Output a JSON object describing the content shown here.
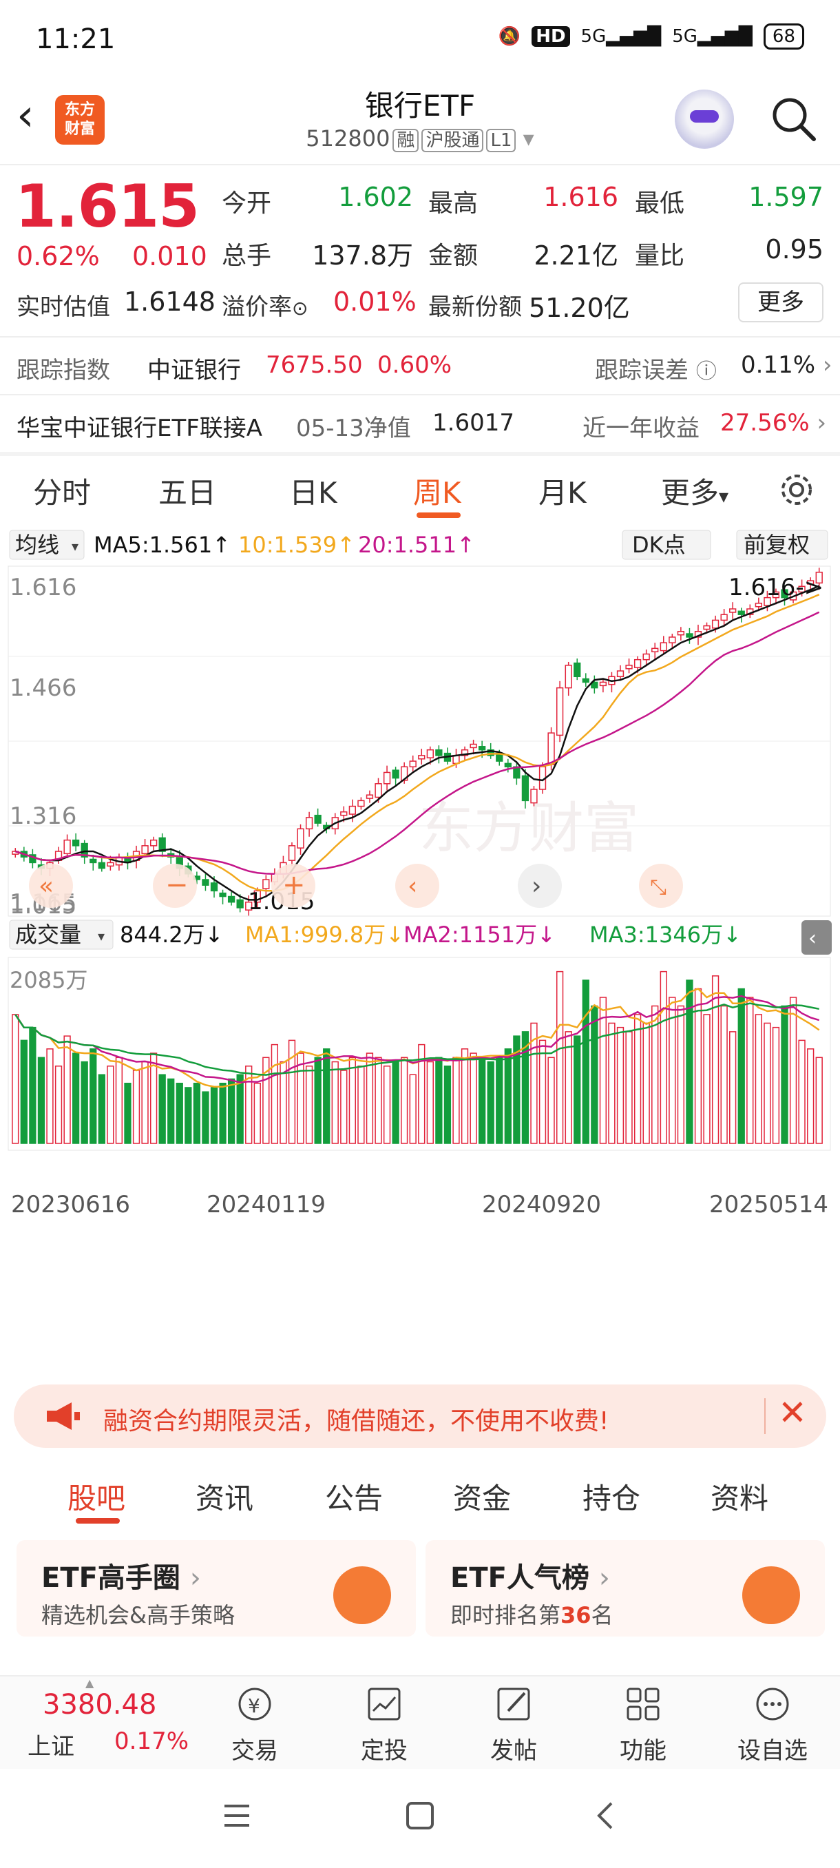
{
  "status": {
    "time": "11:21",
    "network1": "HD",
    "sig1": "5G",
    "sig2": "5G",
    "battery": "68"
  },
  "header": {
    "title": "银行ETF",
    "code": "512800",
    "tag1": "融",
    "tag2": "沪股通",
    "tag3": "L1",
    "logo_line1": "东方",
    "logo_line2": "财富"
  },
  "quote": {
    "price": "1.615",
    "change_pct": "0.62%",
    "change_abs": "0.010",
    "open_label": "今开",
    "open": "1.602",
    "high_label": "最高",
    "high": "1.616",
    "low_label": "最低",
    "low": "1.597",
    "volume_label": "总手",
    "volume": "137.8万",
    "amount_label": "金额",
    "amount": "2.21亿",
    "ratio_label": "量比",
    "ratio": "0.95",
    "iopv_label": "实时估值",
    "iopv": "1.6148",
    "premium_label": "溢价率",
    "premium": "0.01%",
    "shares_label": "最新份额",
    "shares": "51.20亿",
    "more_label": "更多"
  },
  "tracking": {
    "index_label": "跟踪指数",
    "index_name": "中证银行",
    "index_value": "7675.50",
    "index_pct": "0.60%",
    "error_label": "跟踪误差",
    "error_value": "0.11%"
  },
  "feeder": {
    "name": "华宝中证银行ETF联接A",
    "nav_label": "05-13净值",
    "nav": "1.6017",
    "ret_label": "近一年收益",
    "ret": "27.56%"
  },
  "kline_tabs": [
    "分时",
    "五日",
    "日K",
    "周K",
    "月K",
    "更多"
  ],
  "active_tab": "周K",
  "chart_header": {
    "indicator": "均线",
    "ma5": "MA5:1.561↑",
    "ma10": "10:1.539↑",
    "ma20": "20:1.511↑",
    "dk_label": "DK点",
    "adjust_label": "前复权"
  },
  "volume_header": {
    "indicator": "成交量",
    "vol": "844.2万↓",
    "ma1": "MA1:999.8万↓",
    "ma2": "MA2:1151万↓",
    "ma3": "MA3:1346万↓",
    "max_label": "2085万"
  },
  "chart_data": {
    "type": "candlestick",
    "period": "weekly",
    "y_ticks": [
      "1.616",
      "1.466",
      "1.316",
      "1.165",
      "1.015"
    ],
    "ylim": [
      1.015,
      1.616
    ],
    "x_ticks": [
      "20230616",
      "20240119",
      "20240920",
      "20250514"
    ],
    "max_label": "1.616->",
    "min_label": "1.015",
    "ma_colors": {
      "ma5": "#111111",
      "ma10": "#f2a81d",
      "ma20": "#c4168a"
    },
    "close_series": [
      1.12,
      1.11,
      1.1,
      1.09,
      1.1,
      1.12,
      1.14,
      1.13,
      1.11,
      1.1,
      1.09,
      1.1,
      1.11,
      1.1,
      1.12,
      1.13,
      1.14,
      1.12,
      1.11,
      1.09,
      1.08,
      1.07,
      1.06,
      1.05,
      1.04,
      1.03,
      1.02,
      1.03,
      1.05,
      1.07,
      1.08,
      1.1,
      1.13,
      1.16,
      1.18,
      1.17,
      1.16,
      1.18,
      1.19,
      1.2,
      1.21,
      1.22,
      1.24,
      1.26,
      1.25,
      1.27,
      1.28,
      1.29,
      1.3,
      1.29,
      1.28,
      1.29,
      1.3,
      1.31,
      1.3,
      1.29,
      1.28,
      1.27,
      1.25,
      1.21,
      1.23,
      1.27,
      1.33,
      1.41,
      1.45,
      1.43,
      1.42,
      1.41,
      1.42,
      1.43,
      1.44,
      1.45,
      1.46,
      1.47,
      1.48,
      1.49,
      1.5,
      1.51,
      1.5,
      1.51,
      1.52,
      1.53,
      1.54,
      1.55,
      1.54,
      1.55,
      1.56,
      1.57,
      1.58,
      1.57,
      1.58,
      1.59,
      1.6,
      1.615
    ],
    "vol_series": [
      1500,
      1200,
      1350,
      1000,
      1100,
      900,
      1250,
      1050,
      950,
      1100,
      800,
      900,
      1000,
      700,
      850,
      950,
      1050,
      800,
      750,
      700,
      650,
      700,
      600,
      650,
      700,
      750,
      800,
      900,
      700,
      1000,
      1150,
      950,
      1200,
      1050,
      900,
      1000,
      1100,
      950,
      850,
      1000,
      900,
      1050,
      1000,
      900,
      950,
      1000,
      800,
      1150,
      950,
      1000,
      900,
      1000,
      1100,
      1050,
      1000,
      950,
      1000,
      1100,
      1250,
      1300,
      1400,
      1200,
      1000,
      2000,
      1300,
      1250,
      1900,
      1600,
      1700,
      1400,
      1350,
      1300,
      1500,
      1400,
      1600,
      2000,
      1700,
      1600,
      1900,
      1800,
      1500,
      1950,
      1600,
      1300,
      1800,
      1700,
      1500,
      1400,
      1350,
      1600,
      1700,
      1200,
      1100,
      1000
    ]
  },
  "promo": {
    "text": "融资合约期限灵活，随借随还，不使用不收费!"
  },
  "news_tabs": [
    "股吧",
    "资讯",
    "公告",
    "资金",
    "持仓",
    "资料"
  ],
  "cards": [
    {
      "title": "ETF高手圈",
      "sub": "精选机会&高手策略"
    },
    {
      "title": "ETF人气榜",
      "sub_prefix": "即时排名第",
      "sub_num": "36",
      "sub_suffix": "名"
    }
  ],
  "toolbar": {
    "index_price": "3380.48",
    "index_name": "上证",
    "index_pct": "0.17%",
    "items": [
      "交易",
      "定投",
      "发帖",
      "功能",
      "设自选"
    ]
  }
}
